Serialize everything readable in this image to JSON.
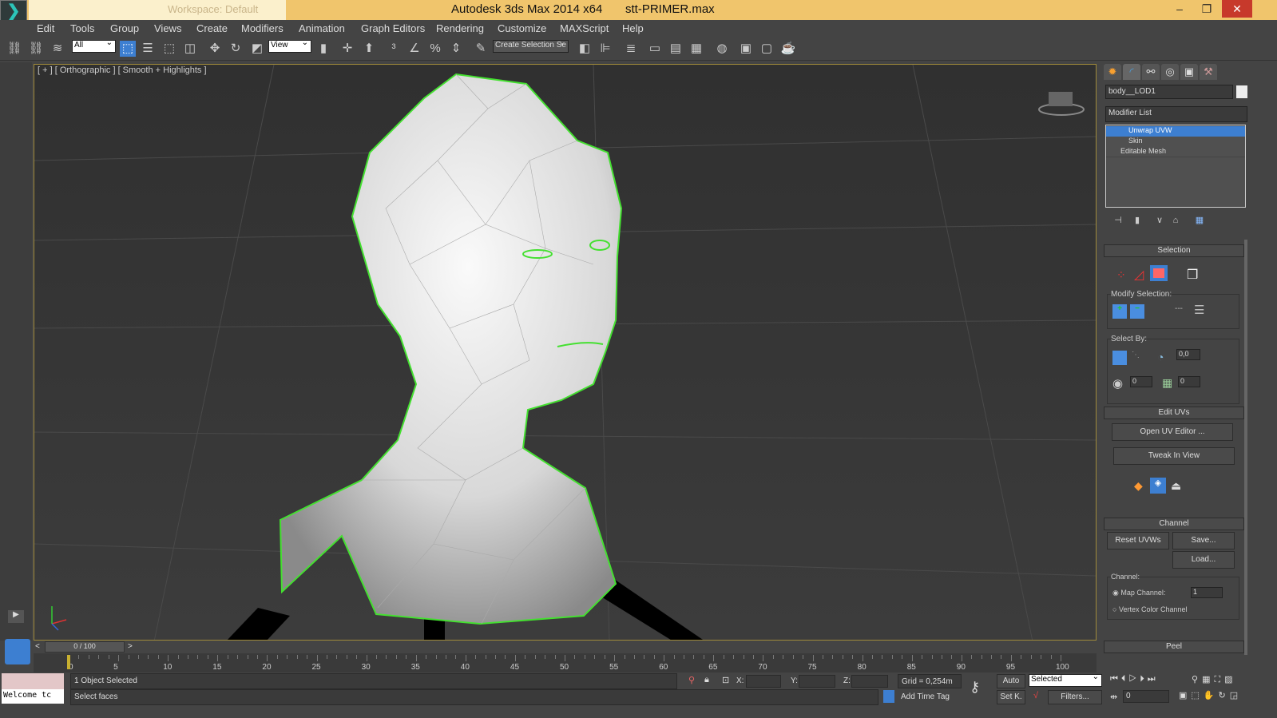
{
  "title_bar": {
    "workspace": "Workspace: Default",
    "app_title": "Autodesk 3ds Max  2014 x64",
    "filename": "stt-PRIMER.max",
    "accent": "#f0c56c"
  },
  "menu": [
    "Edit",
    "Tools",
    "Group",
    "Views",
    "Create",
    "Modifiers",
    "Animation",
    "Graph Editors",
    "Rendering",
    "Customize",
    "MAXScript",
    "Help"
  ],
  "toolbar": {
    "selection_filter": "All",
    "ref_coord": "View",
    "named_selection": "Create Selection Se"
  },
  "viewport": {
    "label": "[ + ] [ Orthographic ] [ Smooth + Highlights ]",
    "selection_edge_color": "#44e030"
  },
  "command_panel": {
    "tabs": [
      "create-icon",
      "modify-icon",
      "hierarchy-icon",
      "motion-icon",
      "display-icon",
      "utilities-icon"
    ],
    "object_name": "body__LOD1",
    "modifier_list": "Modifier List",
    "stack": [
      {
        "label": "Unwrap UVW",
        "selected": true
      },
      {
        "label": "Skin",
        "selected": false
      },
      {
        "label": "Editable Mesh",
        "selected": false
      }
    ],
    "selection": {
      "title": "Selection",
      "modify_label": "Modify Selection:",
      "select_by_label": "Select By:",
      "angle": "0,0",
      "spin1": "0",
      "spin2": "0"
    },
    "edit_uvs": {
      "title": "Edit UVs",
      "open_editor": "Open UV Editor ...",
      "tweak": "Tweak In View"
    },
    "channel": {
      "title": "Channel",
      "reset": "Reset UVWs",
      "save": "Save...",
      "load": "Load...",
      "channel_label": "Channel:",
      "map_channel": "Map Channel:",
      "map_value": "1",
      "vertex_color": "Vertex Color Channel"
    },
    "peel": {
      "title": "Peel"
    }
  },
  "timeline": {
    "frame": "0 / 100",
    "ticks": [
      "0",
      "5",
      "10",
      "15",
      "20",
      "25",
      "30",
      "35",
      "40",
      "45",
      "50",
      "55",
      "60",
      "65",
      "70",
      "75",
      "80",
      "85",
      "90",
      "95",
      "100"
    ]
  },
  "status": {
    "welcome": "Welcome tc",
    "objects": "1 Object Selected",
    "prompt": "Select faces",
    "x_label": "X:",
    "y_label": "Y:",
    "z_label": "Z:",
    "grid": "Grid = 0,254m",
    "add_time_tag": "Add Time Tag",
    "auto": "Auto",
    "set_key": "Set K.",
    "key_filter": "Selected",
    "filters": "Filters...",
    "current_frame": "0"
  }
}
